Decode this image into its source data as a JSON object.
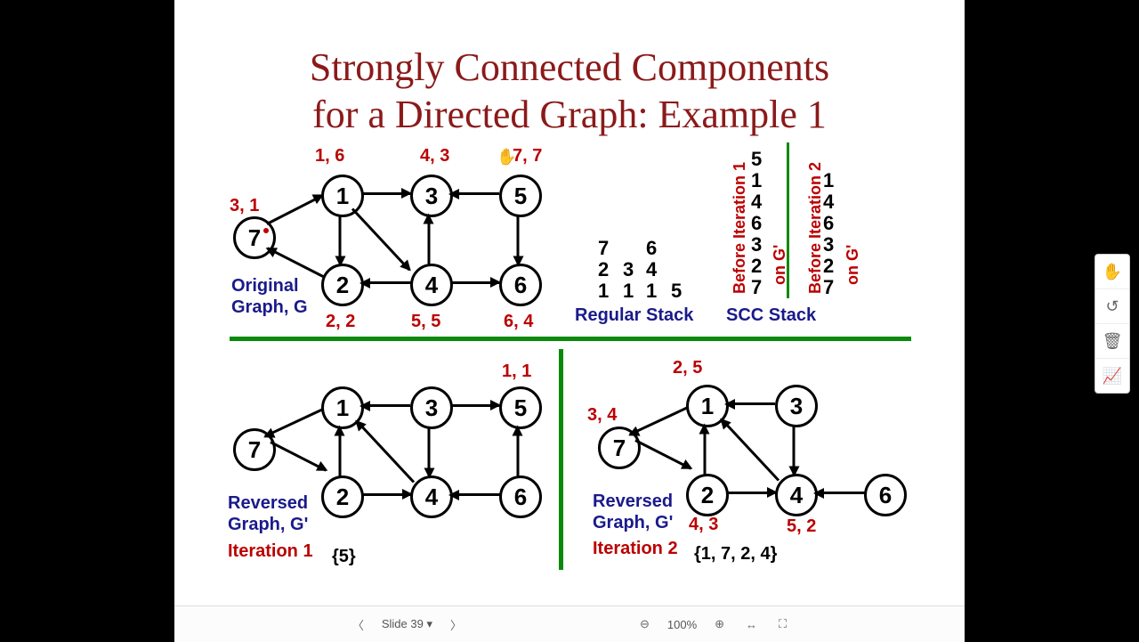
{
  "title_l1": "Strongly Connected Components",
  "title_l2": "for a Directed Graph: Example 1",
  "orig_label_l1": "Original",
  "orig_label_l2": "Graph, G",
  "rev1_l1": "Reversed",
  "rev1_l2": "Graph, G'",
  "rev2_l1": "Reversed",
  "rev2_l2": "Graph, G'",
  "iter1": "Iteration 1",
  "iter1_set": "{5}",
  "iter2": "Iteration 2",
  "iter2_set": "{1, 7, 2, 4}",
  "regstack": "Regular Stack",
  "sccstack": "SCC Stack",
  "before1": "Before Iteration 1",
  "before2": "Before Iteration 2",
  "ongp": "on G'",
  "n": {
    "1": "1",
    "2": "2",
    "3": "3",
    "4": "4",
    "5": "5",
    "6": "6",
    "7": "7"
  },
  "ts": {
    "n1": "1, 6",
    "n3": "4, 3",
    "n5": "7, 7",
    "n7": "3, 1",
    "n2": "2, 2",
    "n4": "5, 5",
    "n6": "6, 4"
  },
  "ts_b": {
    "n5": "1, 1"
  },
  "ts_c": {
    "n1": "2, 5",
    "n7": "3, 4",
    "n2": "4, 3",
    "n4": "5, 2"
  },
  "stack": {
    "c1": [
      "7",
      "2",
      "1"
    ],
    "c2": [
      "3",
      "1"
    ],
    "c3": [
      "6",
      "4",
      "1"
    ],
    "c4": [
      "5"
    ]
  },
  "scc1": [
    "5",
    "1",
    "4",
    "6",
    "3",
    "2",
    "7"
  ],
  "scc2": [
    "1",
    "4",
    "6",
    "3",
    "2",
    "7"
  ],
  "footer": {
    "slide": "Slide 39",
    "zoom": "100%"
  },
  "chart_data": {
    "type": "diagram",
    "title": "Strongly Connected Components for a Directed Graph: Example 1",
    "graph_G": {
      "nodes": [
        1,
        2,
        3,
        4,
        5,
        6,
        7
      ],
      "edges": [
        [
          1,
          3
        ],
        [
          1,
          2
        ],
        [
          1,
          4
        ],
        [
          3,
          4
        ],
        [
          4,
          2
        ],
        [
          4,
          6
        ],
        [
          5,
          3
        ],
        [
          5,
          6
        ],
        [
          2,
          7
        ],
        [
          7,
          1
        ]
      ],
      "dfs_times": {
        "1": [
          1,
          6
        ],
        "2": [
          2,
          2
        ],
        "3": [
          4,
          3
        ],
        "4": [
          5,
          5
        ],
        "5": [
          7,
          7
        ],
        "6": [
          6,
          4
        ],
        "7": [
          3,
          1
        ]
      }
    },
    "regular_stack_snapshots": [
      [
        1,
        2,
        7
      ],
      [
        1,
        3
      ],
      [
        1,
        4,
        6
      ],
      [
        5
      ]
    ],
    "scc_stack_before_iter1": [
      5,
      1,
      4,
      6,
      3,
      2,
      7
    ],
    "scc_stack_before_iter2": [
      1,
      4,
      6,
      3,
      2,
      7
    ],
    "graph_G_reversed": {
      "nodes": [
        1,
        2,
        3,
        4,
        5,
        6,
        7
      ],
      "edges": [
        [
          3,
          1
        ],
        [
          2,
          1
        ],
        [
          4,
          1
        ],
        [
          4,
          3
        ],
        [
          2,
          4
        ],
        [
          6,
          4
        ],
        [
          3,
          5
        ],
        [
          6,
          5
        ],
        [
          7,
          2
        ],
        [
          1,
          7
        ]
      ]
    },
    "iteration1": {
      "start": 5,
      "dfs_times": {
        "5": [
          1,
          1
        ]
      },
      "scc": [
        5
      ]
    },
    "iteration2": {
      "start": 1,
      "dfs_times": {
        "1": [
          2,
          5
        ],
        "7": [
          3,
          4
        ],
        "2": [
          4,
          3
        ],
        "4": [
          5,
          2
        ]
      },
      "scc": [
        1,
        7,
        2,
        4
      ]
    }
  }
}
